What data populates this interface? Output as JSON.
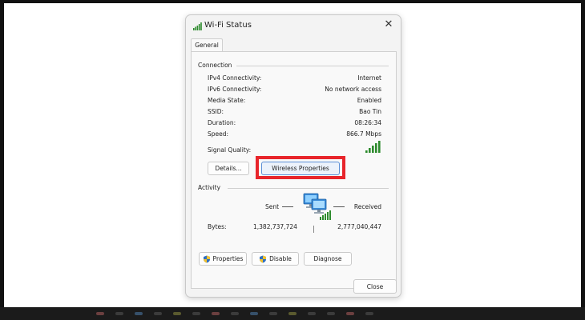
{
  "dialog": {
    "title": "Wi-Fi Status",
    "close_glyph": "✕",
    "tab": "General"
  },
  "connection": {
    "heading": "Connection",
    "rows": [
      {
        "label": "IPv4 Connectivity:",
        "value": "Internet"
      },
      {
        "label": "IPv6 Connectivity:",
        "value": "No network access"
      },
      {
        "label": "Media State:",
        "value": "Enabled"
      },
      {
        "label": "SSID:",
        "value": "Bao Tin"
      },
      {
        "label": "Duration:",
        "value": "08:26:34"
      },
      {
        "label": "Speed:",
        "value": "866.7 Mbps"
      }
    ],
    "signal_label": "Signal Quality:",
    "signal_bars": 5,
    "details_label": "Details...",
    "wireless_properties_label": "Wireless Properties"
  },
  "activity": {
    "heading": "Activity",
    "sent_label": "Sent",
    "received_label": "Received",
    "bytes_label": "Bytes:",
    "bytes_sent": "1,382,737,724",
    "bytes_received": "2,777,040,447",
    "properties_label": "Properties",
    "disable_label": "Disable",
    "diagnose_label": "Diagnose"
  },
  "footer": {
    "close_label": "Close"
  },
  "colors": {
    "highlight": "#e8252b",
    "signal": "#2e8b2e",
    "shield_blue": "#2f6fc2",
    "shield_yellow": "#f2c230"
  },
  "icons": [
    "wifi-signal-icon",
    "close-icon",
    "network-computers-icon",
    "shield-icon"
  ]
}
